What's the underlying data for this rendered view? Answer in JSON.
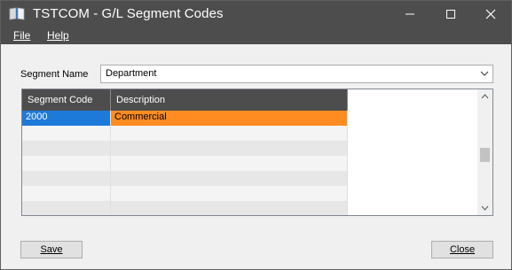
{
  "window": {
    "title": "TSTCOM - G/L Segment Codes"
  },
  "titlebar_buttons": {
    "minimize": "—",
    "maximize": "☐",
    "close": "✕"
  },
  "menu": {
    "file": "File",
    "help": "Help"
  },
  "segment": {
    "label": "Segment Name",
    "value": "Department"
  },
  "grid": {
    "headers": [
      "Segment Code",
      "Description"
    ],
    "rows": [
      {
        "code": "2000",
        "description": "Commercial"
      }
    ]
  },
  "buttons": {
    "save": "Save",
    "close": "Close"
  },
  "colors": {
    "selected_code": "#1e7ad8",
    "selected_description": "#ff8c20",
    "header": "#4d4d4d"
  },
  "icons": {
    "app": "book-icon",
    "dropdown": "chevron-down-icon",
    "scroll_up": "chevron-up-icon",
    "scroll_down": "chevron-down-icon"
  }
}
